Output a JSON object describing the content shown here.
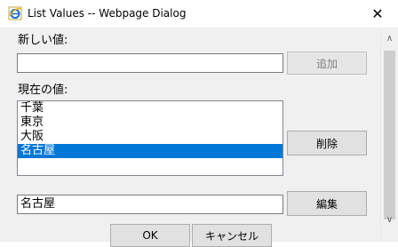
{
  "window": {
    "title": "List Values -- Webpage Dialog",
    "close_glyph": "✕"
  },
  "form": {
    "new_value_label": "新しい値:",
    "new_value_input": "",
    "add_button": "追加",
    "current_value_label": "現在の値:",
    "list_items": [
      "千葉",
      "東京",
      "大阪",
      "名古屋"
    ],
    "selected_index": 3,
    "delete_button": "削除",
    "edit_value_input": "名古屋",
    "edit_button": "編集",
    "ok_button": "OK",
    "cancel_button": "キャンセル"
  },
  "scrollbar": {
    "up_glyph": "∧",
    "down_glyph": "∨"
  },
  "colors": {
    "selection": "#0078d7",
    "dialog_background": "#f0f0f0",
    "ie_icon": "#1e6fd9"
  }
}
